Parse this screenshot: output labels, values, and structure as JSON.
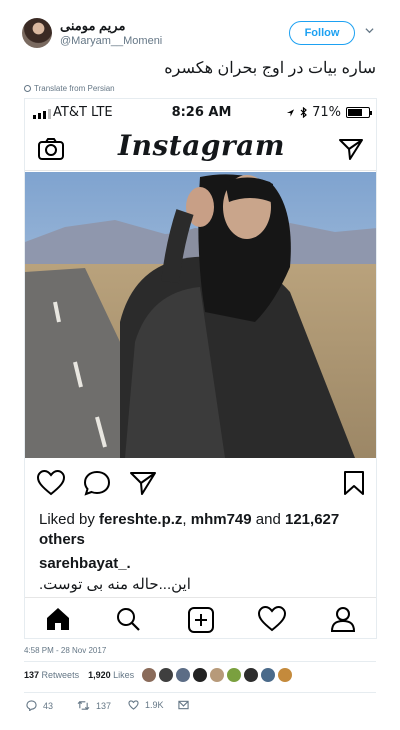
{
  "tweet": {
    "display_name": "مریم مومنی",
    "username": "@Maryam__Momeni",
    "follow_label": "Follow",
    "text": "ساره بیات در اوج بحران هکسره",
    "translate_label": "Translate from Persian",
    "timestamp": "4:58 PM - 28 Nov 2017",
    "retweets_count": "137",
    "retweets_label": "Retweets",
    "likes_count": "1,920",
    "likes_label": "Likes",
    "reply_count": "43",
    "retweet_count": "137",
    "like_count": "1.9K"
  },
  "phone": {
    "carrier": "AT&T  LTE",
    "time": "8:26 AM",
    "battery": "71%",
    "battery_level": 0.71,
    "app_title": "Instagram",
    "liked_prefix": "Liked by ",
    "liked_user1": "fereshte.p.z",
    "liked_sep": ", ",
    "liked_user2": "mhm749",
    "liked_and": " and ",
    "liked_count": "121,627 others",
    "caption_user": "sarehbayat_.",
    "caption_text": "این...حاله منه بی توست."
  },
  "icons": {
    "camera": "camera-icon",
    "send": "send-icon",
    "heart": "heart-icon",
    "comment": "comment-icon",
    "bookmark": "bookmark-icon",
    "home": "home-icon",
    "search": "search-icon",
    "add": "add-post-icon",
    "profile": "profile-icon"
  },
  "colors": {
    "twitter_blue": "#1da1f2",
    "muted": "#657786"
  }
}
